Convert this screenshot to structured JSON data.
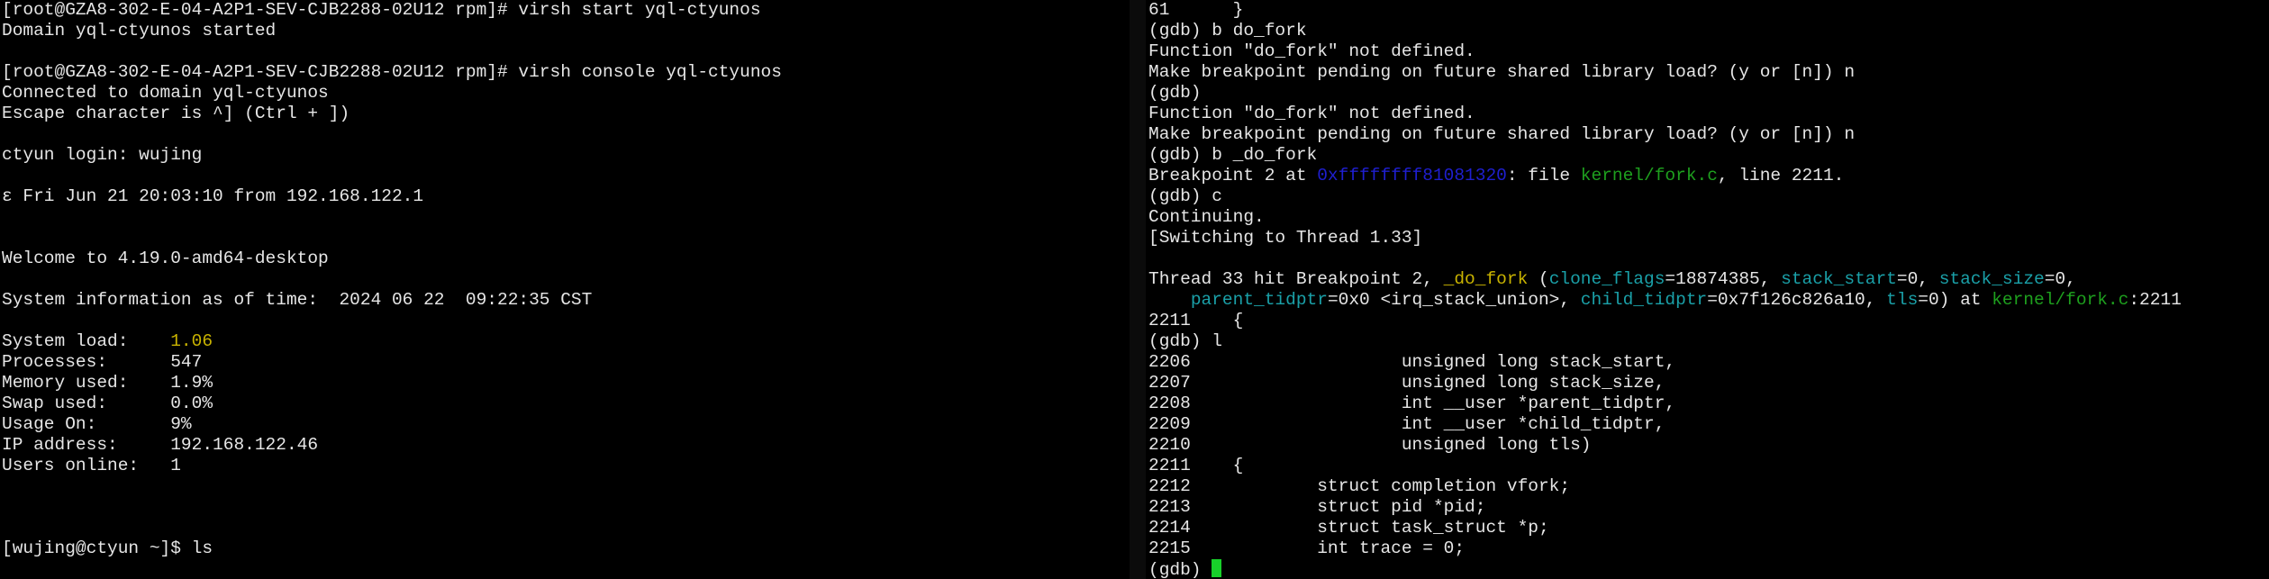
{
  "colors": {
    "background": "#000000",
    "text": "#e6e6e6",
    "yellow": "#c9b300",
    "blue": "#1f1fd0",
    "green": "#1ea01e",
    "cyan": "#1aa0a8",
    "cursor": "#18d02a"
  },
  "left_terminal": {
    "lines": [
      "[root@GZA8-302-E-04-A2P1-SEV-CJB2288-02U12 rpm]# virsh start yql-ctyunos",
      "Domain yql-ctyunos started",
      "",
      "[root@GZA8-302-E-04-A2P1-SEV-CJB2288-02U12 rpm]# virsh console yql-ctyunos",
      "Connected to domain yql-ctyunos",
      "Escape character is ^] (Ctrl + ])",
      "",
      "ctyun login: wujing",
      "",
      "ε Fri Jun 21 20:03:10 from 192.168.122.1",
      "",
      "",
      "Welcome to 4.19.0-amd64-desktop",
      "",
      "System information as of time:  2024 06 22  09:22:35 CST",
      "",
      "",
      "Processes:      547",
      "Memory used:    1.9%",
      "Swap used:      0.0%",
      "Usage On:       9%",
      "IP address:     192.168.122.46",
      "Users online:   1",
      "",
      "",
      "",
      "[wujing@ctyun ~]$ ls"
    ],
    "system_load_label": "System load:    ",
    "system_load_value": "1.06"
  },
  "right_terminal": {
    "l01": "61      }",
    "l02": "(gdb) b do_fork",
    "l03": "Function \"do_fork\" not defined.",
    "l04": "Make breakpoint pending on future shared library load? (y or [n]) n",
    "l05": "(gdb)",
    "l06": "Function \"do_fork\" not defined.",
    "l07": "Make breakpoint pending on future shared library load? (y or [n]) n",
    "l08": "(gdb) b _do_fork",
    "bp_prefix": "Breakpoint 2 at ",
    "bp_addr": "0xffffffff81081320",
    "bp_mid": ": file ",
    "bp_file": "kernel/fork.c",
    "bp_suffix": ", line 2211.",
    "l10": "(gdb) c",
    "l11": "Continuing.",
    "l12": "[Switching to Thread 1.33]",
    "hit_prefix": "Thread 33 hit Breakpoint 2, ",
    "hit_func": "_do_fork",
    "hit_open": " (",
    "arg1": "clone_flags",
    "arg1v": "=18874385, ",
    "arg2": "stack_start",
    "arg2v": "=0, ",
    "arg3": "stack_size",
    "arg3v": "=0,",
    "cont_indent": "    ",
    "arg4": "parent_tidptr",
    "arg4v": "=0x0 <irq_stack_union>, ",
    "arg5": "child_tidptr",
    "arg5v": "=0x7f126c826a10, ",
    "arg6": "tls",
    "arg6v": "=0) at ",
    "at_file": "kernel/fork.c",
    "at_line": ":2211",
    "code_lines": [
      "2211    {",
      "(gdb) l",
      "2206                    unsigned long stack_start,",
      "2207                    unsigned long stack_size,",
      "2208                    int __user *parent_tidptr,",
      "2209                    int __user *child_tidptr,",
      "2210                    unsigned long tls)",
      "2211    {",
      "2212            struct completion vfork;",
      "2213            struct pid *pid;",
      "2214            struct task_struct *p;",
      "2215            int trace = 0;"
    ],
    "prompt": "(gdb) "
  }
}
